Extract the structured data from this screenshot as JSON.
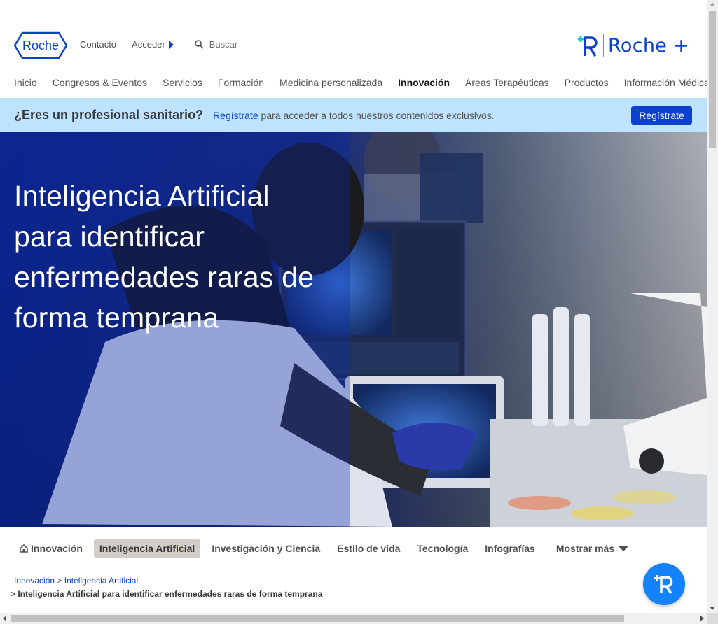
{
  "header": {
    "logo_text": "Roche",
    "links": {
      "contact": "Contacto",
      "login": "Acceder"
    },
    "search_placeholder": "Buscar",
    "brand_plus": "Roche +"
  },
  "nav": {
    "items": [
      {
        "label": "Inicio"
      },
      {
        "label": "Congresos & Eventos"
      },
      {
        "label": "Servicios"
      },
      {
        "label": "Formación"
      },
      {
        "label": "Medicina personalizada"
      },
      {
        "label": "Innovación",
        "active": true
      },
      {
        "label": "Áreas Terapéuticas"
      },
      {
        "label": "Productos"
      },
      {
        "label": "Información Médica"
      }
    ]
  },
  "banner": {
    "question": "¿Eres un profesional sanitario?",
    "link": "Regístrate",
    "text": " para acceder a todos nuestros contenidos exclusivos.",
    "button": "Regístrate"
  },
  "hero": {
    "title": "Inteligencia Artificial para identificar enfermedades raras de forma temprana"
  },
  "subnav": {
    "items": [
      {
        "label": "Innovación",
        "icon": "home-icon"
      },
      {
        "label": "Inteligencia Artificial",
        "active": true
      },
      {
        "label": "Investigación y Ciencia"
      },
      {
        "label": "Estilo de vida"
      },
      {
        "label": "Tecnología"
      },
      {
        "label": "Infografías"
      }
    ],
    "more": "Mostrar más"
  },
  "breadcrumb": {
    "items": [
      "Innovación",
      "Inteligencia Artificial"
    ],
    "current": "Inteligencia Artificial para identificar enfermedades raras de forma temprana"
  },
  "colors": {
    "brand_blue": "#0b41cd",
    "banner_bg": "#bde3ff",
    "fab_blue": "#1482fa",
    "active_tab_bg": "#d4cdc7"
  }
}
